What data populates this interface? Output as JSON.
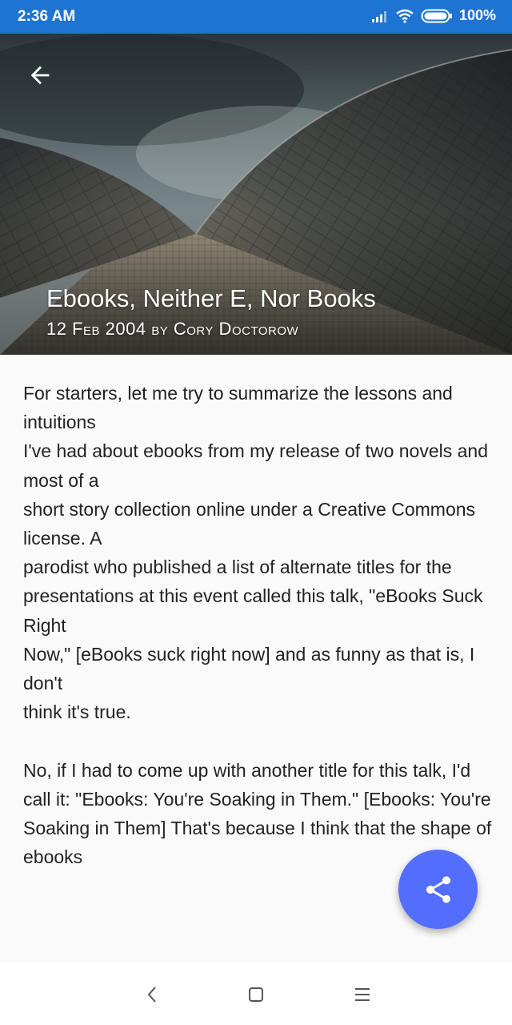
{
  "status_bar": {
    "time": "2:36 AM",
    "battery": "100%",
    "icons": [
      "signal-icon",
      "wifi-icon",
      "battery-icon"
    ],
    "background": "#1e74d2"
  },
  "hero": {
    "title": "Ebooks, Neither E, Nor Books",
    "subtitle": "12 Feb 2004 by Cory Doctorow",
    "back_icon": "arrow-left-icon"
  },
  "article": {
    "body": "For starters, let me try to summarize the lessons and intuitions\nI've had about ebooks from my release of two novels and most of a\nshort story collection online under a Creative Commons license. A\nparodist who published a list of alternate titles for the\npresentations at this event called this talk, \"eBooks Suck Right\nNow,\" [eBooks suck right now] and as funny as that is, I don't\nthink it's true.\n\nNo, if I had to come up with another title for this talk, I'd\ncall it: \"Ebooks: You're Soaking in Them.\" [Ebooks: You're\nSoaking in Them] That's because I think that the shape of ebooks"
  },
  "fab": {
    "icon": "share-icon",
    "color": "#536dfe"
  },
  "nav_bar": {
    "icons": [
      "back-nav-icon",
      "home-nav-icon",
      "menu-nav-icon"
    ]
  }
}
